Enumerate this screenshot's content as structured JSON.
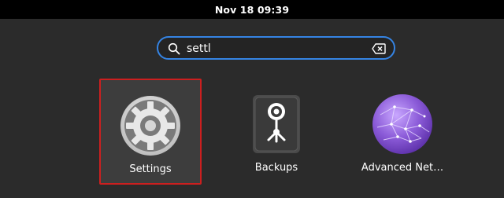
{
  "topbar": {
    "clock": "Nov 18  09:39"
  },
  "search": {
    "value": "settl"
  },
  "results": [
    {
      "label": "Settings",
      "icon": "settings-gear-icon",
      "selected": true
    },
    {
      "label": "Backups",
      "icon": "backups-vault-icon",
      "selected": false
    },
    {
      "label": "Advanced Net…",
      "icon": "network-globe-icon",
      "selected": false
    }
  ],
  "colors": {
    "focus_ring": "#3584e4",
    "selection_outline": "#cc1f1f",
    "background": "#2b2b2b",
    "topbar": "#000000"
  }
}
